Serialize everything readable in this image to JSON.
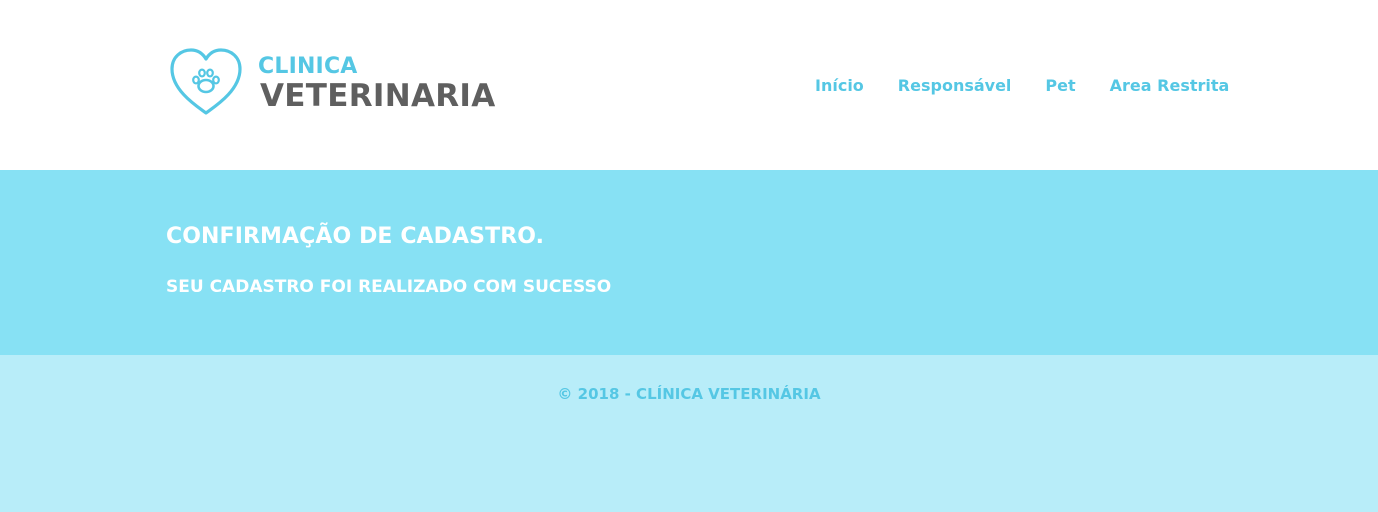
{
  "logo": {
    "top_text": "CLINICA",
    "bottom_text": "VETERINARIA",
    "icon": "heart-paw-icon"
  },
  "nav": {
    "items": [
      {
        "label": "Início"
      },
      {
        "label": "Responsável"
      },
      {
        "label": "Pet"
      },
      {
        "label": "Area Restrita"
      }
    ]
  },
  "banner": {
    "title": "CONFIRMAÇÃO DE CADASTRO.",
    "subtitle": "SEU CADASTRO FOI REALIZADO COM SUCESSO"
  },
  "footer": {
    "copyright": "© 2018 - CLÍNICA VETERINÁRIA"
  },
  "colors": {
    "accent": "#55c7e4",
    "banner_bg": "#87e1f4",
    "footer_bg": "#b8edf9",
    "logo_dark": "#5f5f5f"
  }
}
